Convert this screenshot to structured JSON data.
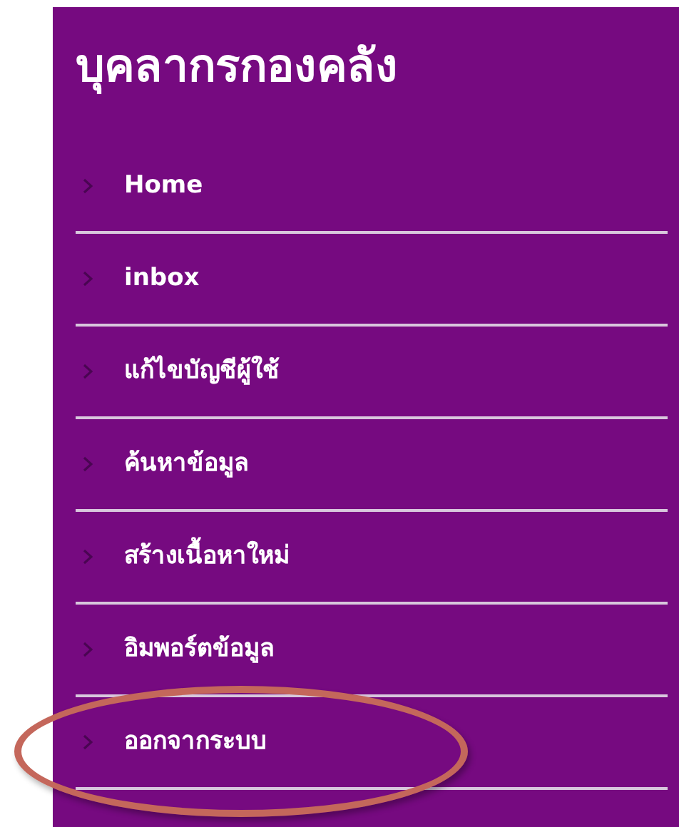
{
  "sidebar": {
    "title": "บุคลากรกองคลัง",
    "items": [
      {
        "label": "Home",
        "highlighted": false
      },
      {
        "label": "inbox",
        "highlighted": false
      },
      {
        "label": "แก้ไขบัญชีผู้ใช้",
        "highlighted": false
      },
      {
        "label": "ค้นหาข้อมูล",
        "highlighted": false
      },
      {
        "label": "สร้างเนื้อหาใหม่",
        "highlighted": false
      },
      {
        "label": "อิมพอร์ตข้อมูล",
        "highlighted": false
      },
      {
        "label": "ออกจากระบบ",
        "highlighted": true
      }
    ]
  }
}
